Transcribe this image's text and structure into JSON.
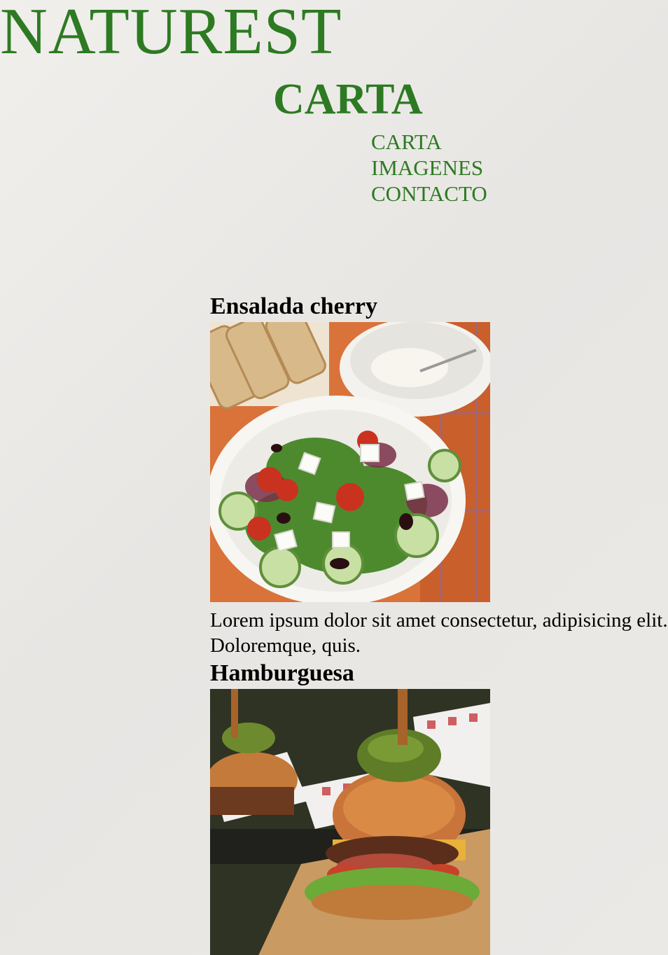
{
  "header": {
    "brand": "NATUREST",
    "page_title": "CARTA"
  },
  "nav": {
    "items": [
      {
        "label": "CARTA"
      },
      {
        "label": "IMAGENES"
      },
      {
        "label": "CONTACTO"
      }
    ]
  },
  "menu": {
    "items": [
      {
        "title": "Ensalada cherry",
        "description": "Lorem ipsum dolor sit amet consectetur, adipisicing elit. Doloremque, quis."
      },
      {
        "title": "Hamburguesa"
      }
    ]
  },
  "colors": {
    "accent": "#2d7a22",
    "background": "#e9e7e4"
  }
}
